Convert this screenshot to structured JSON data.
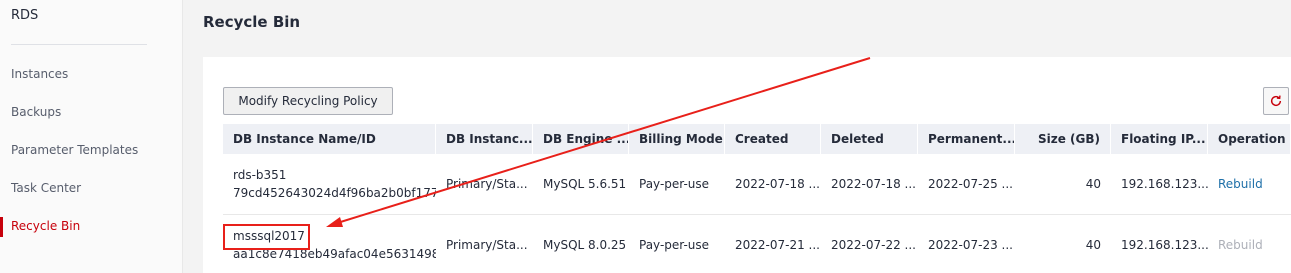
{
  "sidebar": {
    "app_title": "RDS",
    "items": [
      {
        "label": "Instances",
        "active": false
      },
      {
        "label": "Backups",
        "active": false
      },
      {
        "label": "Parameter Templates",
        "active": false
      },
      {
        "label": "Task Center",
        "active": false
      },
      {
        "label": "Recycle Bin",
        "active": true
      }
    ]
  },
  "header": {
    "title": "Recycle Bin"
  },
  "toolbar": {
    "modify_policy_label": "Modify Recycling Policy",
    "refresh_icon": "refresh-icon"
  },
  "table": {
    "columns": [
      "DB Instance Name/ID",
      "DB Instanc...",
      "DB Engine ...",
      "Billing Mode",
      "Created",
      "Deleted",
      "Permanent...",
      "Size (GB)",
      "Floating IP...",
      "Operation"
    ],
    "rows": [
      {
        "name": "rds-b351",
        "id": "79cd452643024d4f96ba2b0bf177...",
        "type": "Primary/Sta...",
        "engine": "MySQL 5.6.51",
        "billing": "Pay-per-use",
        "created": "2022-07-18 ...",
        "deleted": "2022-07-18 ...",
        "permanent": "2022-07-25 ...",
        "size": "40",
        "floating_ip": "192.168.123....",
        "operation": "Rebuild",
        "operation_enabled": true
      },
      {
        "name": "msssql2017",
        "id": "aa1c8e7418eb49afac04e5631498...",
        "type": "Primary/Sta...",
        "engine": "MySQL 8.0.25",
        "billing": "Pay-per-use",
        "created": "2022-07-21 ...",
        "deleted": "2022-07-22 ...",
        "permanent": "2022-07-23 ...",
        "size": "40",
        "floating_ip": "192.168.123....",
        "operation": "Rebuild",
        "operation_enabled": false
      }
    ]
  },
  "colors": {
    "accent": "#c7000b",
    "link": "#1e6fa8",
    "annotation": "#e8201a"
  }
}
